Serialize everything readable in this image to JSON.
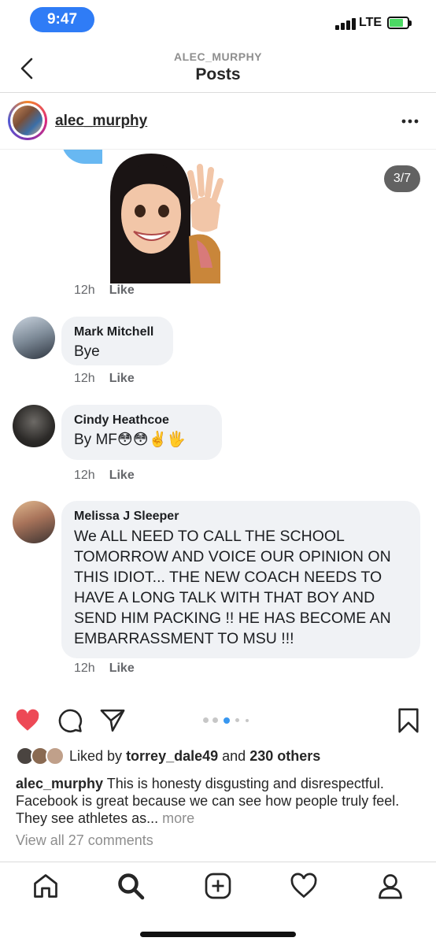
{
  "status_bar": {
    "time": "9:47",
    "network": "LTE"
  },
  "nav": {
    "subtitle": "ALEC_MURPHY",
    "title": "Posts"
  },
  "post": {
    "username": "alec_murphy",
    "image_counter": "3/7",
    "carousel": {
      "count": 5,
      "active_index": 2
    }
  },
  "screenshot_comments": {
    "sticker_meta": {
      "time": "12h",
      "like": "Like"
    },
    "items": [
      {
        "name": "Mark Mitchell",
        "text": "Bye",
        "time": "12h",
        "like": "Like"
      },
      {
        "name": "Cindy Heathcoe",
        "text": "By MF😳😳✌️🖐",
        "time": "12h",
        "like": "Like"
      },
      {
        "name": "Melissa J Sleeper",
        "text": "We ALL NEED TO CALL THE SCHOOL TOMORROW AND VOICE OUR OPINION ON THIS IDIOT... THE NEW COACH NEEDS TO HAVE A LONG TALK WITH THAT BOY AND SEND HIM PACKING !! HE HAS BECOME AN EMBARRASSMENT TO MSU !!!",
        "time": "12h",
        "like": "Like"
      }
    ]
  },
  "liked_by": {
    "prefix": "Liked by",
    "user": "torrey_dale49",
    "and": "and",
    "others": "230 others"
  },
  "caption": {
    "username": "alec_murphy",
    "text": "This is honesty disgusting and disrespectful. Facebook is great because we can see how people truly feel. They see athletes as...",
    "more": "more"
  },
  "view_all_comments": "View all 27 comments",
  "icons": {
    "like": "heart-icon",
    "comment": "comment-icon",
    "share": "share-icon",
    "save": "bookmark-icon",
    "tabs": [
      "home-icon",
      "search-icon",
      "add-post-icon",
      "activity-heart-icon",
      "profile-icon"
    ]
  },
  "colors": {
    "accent": "#2f7cf6",
    "like_red": "#ed4956",
    "carousel_active": "#3897f0"
  }
}
